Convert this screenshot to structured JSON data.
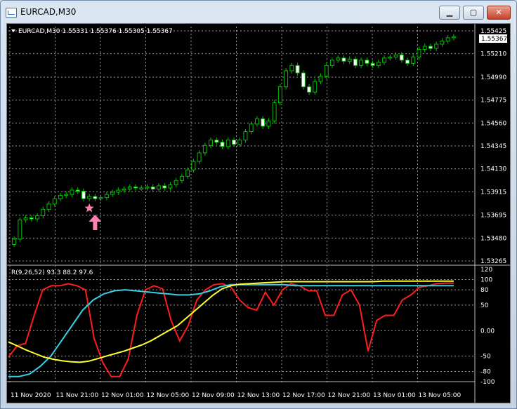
{
  "window": {
    "title": "EURCAD,M30",
    "minimize_glyph": "▁",
    "maximize_glyph": "▢",
    "close_glyph": "✕"
  },
  "chart_info": "EURCAD,M30  1.55331 1.55376 1.55305 1.55367",
  "indicator_info": "R(9,26,52) 93.3 88.2 97.6",
  "current_price": "1.55367",
  "colors": {
    "background": "#000000",
    "grid": "#9a9a9a",
    "candle_up": "#00c000",
    "candle_down_fill": "#ffffff",
    "indicator_fast": "#ff1c1c",
    "indicator_mid": "#36d1e6",
    "indicator_slow": "#ffff33",
    "marker": "#ff7fb0"
  },
  "icons": [
    "app-chart-icon",
    "dropdown-triangle-icon",
    "star-marker-icon",
    "buy-arrow-icon"
  ],
  "chart_data": [
    {
      "type": "candlestick",
      "title": "EURCAD,M30",
      "y_ticks": [
        "1.55425",
        "1.55210",
        "1.54990",
        "1.54775",
        "1.54560",
        "1.54345",
        "1.54130",
        "1.53915",
        "1.53695",
        "1.53480",
        "1.53265"
      ],
      "ylim": [
        1.53265,
        1.55425
      ],
      "closes": [
        1.5347,
        1.5365,
        1.5367,
        1.5366,
        1.5369,
        1.5375,
        1.538,
        1.5385,
        1.5388,
        1.5389,
        1.5393,
        1.5392,
        1.5385,
        1.5387,
        1.5385,
        1.5386,
        1.5389,
        1.5391,
        1.5393,
        1.5394,
        1.5396,
        1.5395,
        1.5395,
        1.5396,
        1.5394,
        1.5397,
        1.5395,
        1.5398,
        1.5402,
        1.5406,
        1.5412,
        1.542,
        1.5428,
        1.5435,
        1.544,
        1.5438,
        1.5434,
        1.544,
        1.5436,
        1.544,
        1.5448,
        1.5455,
        1.546,
        1.5453,
        1.5458,
        1.5475,
        1.549,
        1.5505,
        1.551,
        1.5503,
        1.549,
        1.5485,
        1.5495,
        1.55,
        1.551,
        1.5515,
        1.5517,
        1.5514,
        1.5516,
        1.551,
        1.5515,
        1.5512,
        1.551,
        1.5513,
        1.5517,
        1.5518,
        1.552,
        1.5515,
        1.5512,
        1.5518,
        1.5525,
        1.5528,
        1.5526,
        1.553,
        1.5533,
        1.5536,
        1.5537
      ],
      "x_ticks": [
        "11 Nov 2020",
        "11 Nov 21:00",
        "12 Nov 01:00",
        "12 Nov 05:00",
        "12 Nov 09:00",
        "12 Nov 13:00",
        "12 Nov 17:00",
        "12 Nov 21:00",
        "13 Nov 01:00",
        "13 Nov 05:00"
      ],
      "markers": [
        {
          "kind": "star",
          "bar": 13,
          "price": 1.5376
        },
        {
          "kind": "up-arrow",
          "bar": 14,
          "price": 1.537
        }
      ]
    },
    {
      "type": "line",
      "title": "R(9,26,52) 93.3 88.2 97.6",
      "y_ticks": [
        "120",
        "100",
        "80",
        "50",
        "0.00",
        "-50",
        "-80",
        "-100"
      ],
      "ylim": [
        -100,
        120
      ],
      "series": [
        {
          "color": "#ff1c1c",
          "values": [
            -52,
            -30,
            -25,
            30,
            80,
            88,
            88,
            92,
            88,
            80,
            -15,
            -62,
            -90,
            -90,
            -55,
            30,
            80,
            88,
            82,
            20,
            -20,
            10,
            60,
            80,
            90,
            92,
            85,
            60,
            45,
            40,
            75,
            50,
            80,
            92,
            88,
            78,
            78,
            30,
            30,
            70,
            80,
            50,
            -40,
            20,
            30,
            30,
            60,
            70,
            85,
            88,
            92,
            93,
            93
          ]
        },
        {
          "color": "#36d1e6",
          "values": [
            -90,
            -90,
            -85,
            -70,
            -50,
            -20,
            10,
            40,
            60,
            72,
            78,
            80,
            78,
            76,
            74,
            72,
            70,
            70,
            72,
            78,
            86,
            90,
            90,
            90,
            90,
            90,
            90,
            88,
            88,
            88,
            88,
            88,
            88,
            88,
            88,
            88,
            88,
            88,
            88,
            88,
            88,
            88,
            88
          ]
        },
        {
          "color": "#ffff33",
          "values": [
            -22,
            -30,
            -38,
            -45,
            -52,
            -56,
            -59,
            -61,
            -62,
            -60,
            -55,
            -50,
            -45,
            -40,
            -34,
            -28,
            -20,
            -10,
            0,
            10,
            25,
            40,
            55,
            70,
            82,
            88,
            91,
            92,
            93,
            94,
            95,
            96,
            96,
            96,
            96,
            96,
            96,
            96,
            96,
            96,
            96,
            96,
            97,
            97,
            97,
            97,
            97,
            97,
            97,
            97,
            97
          ]
        }
      ]
    }
  ]
}
